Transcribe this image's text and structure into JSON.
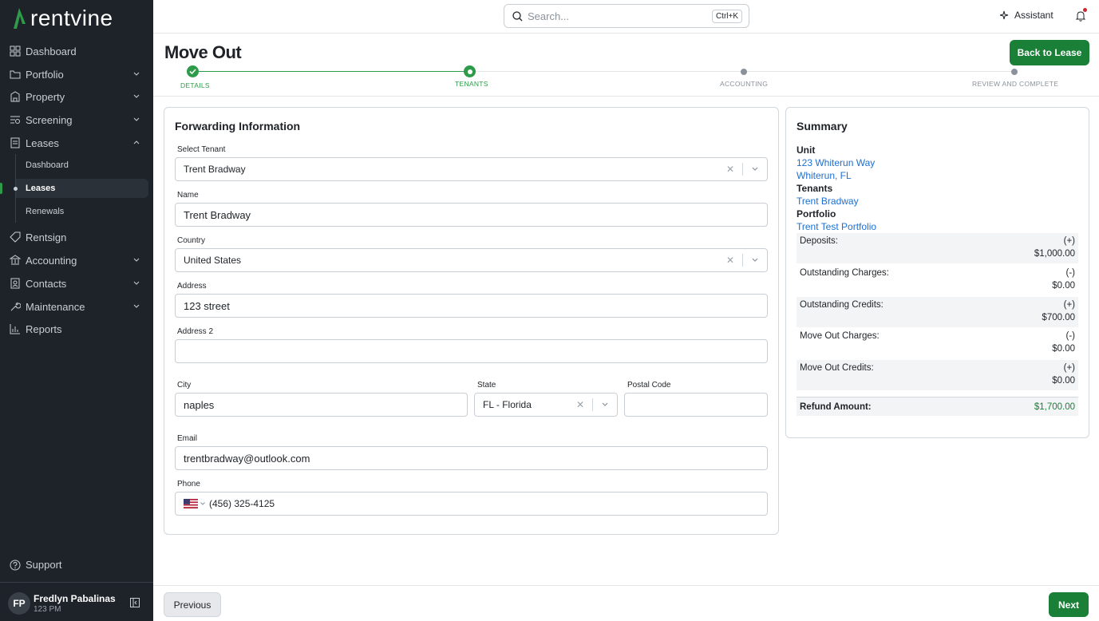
{
  "app": {
    "name": "rentvine"
  },
  "search": {
    "placeholder": "Search...",
    "shortcut": "Ctrl+K"
  },
  "topbar": {
    "assistant_label": "Assistant"
  },
  "sidebar": {
    "items": [
      {
        "label": "Dashboard",
        "icon": "grid-icon"
      },
      {
        "label": "Portfolio",
        "icon": "folder-icon"
      },
      {
        "label": "Property",
        "icon": "building-icon"
      },
      {
        "label": "Screening",
        "icon": "screening-icon"
      },
      {
        "label": "Leases",
        "icon": "document-icon"
      },
      {
        "label": "Rentsign",
        "icon": "tag-icon"
      },
      {
        "label": "Accounting",
        "icon": "bank-icon"
      },
      {
        "label": "Contacts",
        "icon": "contacts-icon"
      },
      {
        "label": "Maintenance",
        "icon": "wrench-icon"
      },
      {
        "label": "Reports",
        "icon": "bar-chart-icon"
      }
    ],
    "sub_items": [
      "Dashboard",
      "Leases",
      "Renewals"
    ],
    "support_label": "Support",
    "user": {
      "initials": "FP",
      "name": "Fredlyn Pabalinas",
      "sub": "123 PM"
    }
  },
  "header": {
    "title": "Move Out",
    "back_button": "Back to Lease"
  },
  "stepper": {
    "steps": [
      {
        "label": "DETAILS",
        "state": "done"
      },
      {
        "label": "TENANTS",
        "state": "current"
      },
      {
        "label": "ACCOUNTING",
        "state": "pending"
      },
      {
        "label": "REVIEW AND COMPLETE",
        "state": "pending"
      }
    ]
  },
  "form": {
    "title": "Forwarding Information",
    "select_tenant": {
      "label": "Select Tenant",
      "value": "Trent Bradway"
    },
    "name": {
      "label": "Name",
      "value": "Trent Bradway"
    },
    "country": {
      "label": "Country",
      "value": "United States"
    },
    "address": {
      "label": "Address",
      "value": "123 street"
    },
    "address2": {
      "label": "Address 2",
      "value": ""
    },
    "city": {
      "label": "City",
      "value": "naples"
    },
    "state": {
      "label": "State",
      "value": "FL - Florida"
    },
    "postal": {
      "label": "Postal Code",
      "value": ""
    },
    "email": {
      "label": "Email",
      "value": "trentbradway@outlook.com"
    },
    "phone": {
      "label": "Phone",
      "value": "(456) 325-4125"
    }
  },
  "summary": {
    "title": "Summary",
    "unit_label": "Unit",
    "unit_line1": "123 Whiterun Way",
    "unit_line2": "Whiterun, FL",
    "tenants_label": "Tenants",
    "tenant": "Trent Bradway",
    "portfolio_label": "Portfolio",
    "portfolio": "Trent Test Portfolio",
    "rows": [
      {
        "label": "Deposits:",
        "sign": "(+)",
        "amount": "$1,000.00"
      },
      {
        "label": "Outstanding Charges:",
        "sign": "(-)",
        "amount": "$0.00"
      },
      {
        "label": "Outstanding Credits:",
        "sign": "(+)",
        "amount": "$700.00"
      },
      {
        "label": "Move Out Charges:",
        "sign": "(-)",
        "amount": "$0.00"
      },
      {
        "label": "Move Out Credits:",
        "sign": "(+)",
        "amount": "$0.00"
      }
    ],
    "refund_label": "Refund Amount:",
    "refund_amount": "$1,700.00"
  },
  "footer": {
    "previous": "Previous",
    "next": "Next"
  },
  "colors": {
    "brand_green": "#1a7f37",
    "sidebar_bg": "#1e2329",
    "link_blue": "#1e6fd0"
  }
}
